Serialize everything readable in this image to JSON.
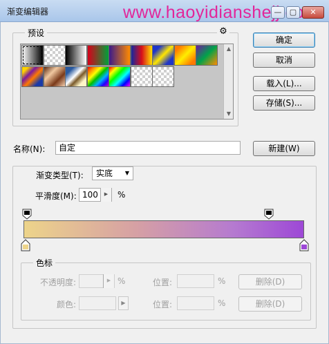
{
  "window": {
    "title": "渐变编辑器",
    "watermark": "www.haoyidianshejj.co",
    "minimize": "—",
    "maximize": "▢",
    "close": "✕"
  },
  "presets": {
    "label": "预设",
    "gear_icon": "gear-icon",
    "scroll_up": "▲",
    "scroll_down": "▼",
    "swatches": [
      {
        "name": "black-white",
        "css": "linear-gradient(to right,#ffffff,#000000)"
      },
      {
        "name": "foreground-transparent",
        "css": "checker"
      },
      {
        "name": "black-to-white",
        "css": "linear-gradient(to right,#000000,#ffffff)"
      },
      {
        "name": "red-green",
        "css": "linear-gradient(to right,#d8001a,#00a13a)"
      },
      {
        "name": "violet-orange",
        "css": "linear-gradient(to right,#3b1a8a,#ff8a00)"
      },
      {
        "name": "blue-red-yellow",
        "css": "linear-gradient(to right,#1428a0,#d80e1a,#ffe000)"
      },
      {
        "name": "blue-yellow-blue",
        "css": "linear-gradient(135deg,#1f36c8 20%,#ffe600 50%,#1f36c8 80%)"
      },
      {
        "name": "orange-yellow-orange",
        "css": "linear-gradient(135deg,#ff7a00 15%,#ffee00 50%,#ff7a00 85%)"
      },
      {
        "name": "violet-green-orange",
        "css": "linear-gradient(135deg,#6e1ca0,#00a24a,#ff8c00)"
      },
      {
        "name": "yellow-violet-orange-blue",
        "css": "linear-gradient(135deg,#ffd400 15%,#7a1aa0 35%,#ff7a00 55%,#1a3aa8 80%)"
      },
      {
        "name": "copper",
        "css": "linear-gradient(135deg,#5a2a14,#f0c8a0,#7a3a1a,#f4d0b0)"
      },
      {
        "name": "chrome",
        "css": "linear-gradient(135deg,#2a5aa0 20%,#ffffff 45%,#7a5a2a 60%,#fff6c8 80%)"
      },
      {
        "name": "spectrum",
        "css": "linear-gradient(135deg,#ff0000,#ff8c00,#ffff00,#00c000,#00b0ff,#2000ff,#c000c0)"
      },
      {
        "name": "transparent-rainbow",
        "css": "linear-gradient(135deg,#ff0000,#ffff00,#00ff00,#00ffff,#0000ff,#ff00ff)"
      },
      {
        "name": "transparent-stripes",
        "css": "checker"
      },
      {
        "name": "neutral-density",
        "css": "checker"
      }
    ]
  },
  "buttons": {
    "ok": "确定",
    "cancel": "取消",
    "load": "载入(L)...",
    "save": "存储(S)...",
    "new": "新建(W)"
  },
  "name_row": {
    "label": "名称(N):",
    "value": "自定"
  },
  "gradient": {
    "type_label": "渐变类型(T):",
    "type_value": "实底",
    "smoothness_label": "平滑度(M):",
    "smoothness_value": "100",
    "smoothness_unit": "%",
    "bar_colors": [
      "#edd48a",
      "#d6a0a4",
      "#b57ad0",
      "#9d48d6"
    ]
  },
  "color_stops": {
    "label": "色标",
    "opacity_label": "不透明度:",
    "opacity_value": "",
    "opacity_unit": "%",
    "location_label": "位置:",
    "location_value": "",
    "location_unit": "%",
    "delete": "删除(D)",
    "color_label": "颜色:",
    "color_value": "",
    "location2_label": "位置:",
    "location2_value": "",
    "location2_unit": "%",
    "delete2": "删除(D)"
  }
}
